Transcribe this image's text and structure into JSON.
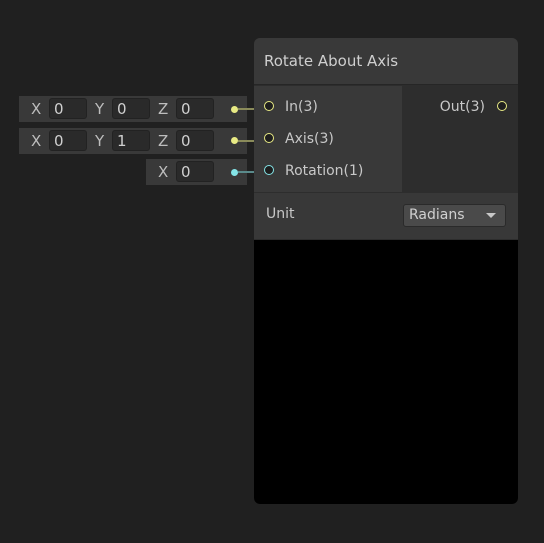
{
  "node": {
    "title": "Rotate About Axis",
    "inputs": [
      {
        "label": "In(3)",
        "color": "#e8ea84"
      },
      {
        "label": "Axis(3)",
        "color": "#e8ea84"
      },
      {
        "label": "Rotation(1)",
        "color": "#84e4e7"
      }
    ],
    "outputs": [
      {
        "label": "Out(3)",
        "color": "#e8ea84"
      }
    ],
    "unit": {
      "label": "Unit",
      "value": "Radians"
    }
  },
  "input_fields": [
    {
      "x_label": "X",
      "x": "0",
      "y_label": "Y",
      "y": "0",
      "z_label": "Z",
      "z": "0"
    },
    {
      "x_label": "X",
      "x": "0",
      "y_label": "Y",
      "y": "1",
      "z_label": "Z",
      "z": "0"
    },
    {
      "x_label": "X",
      "x": "0"
    }
  ]
}
